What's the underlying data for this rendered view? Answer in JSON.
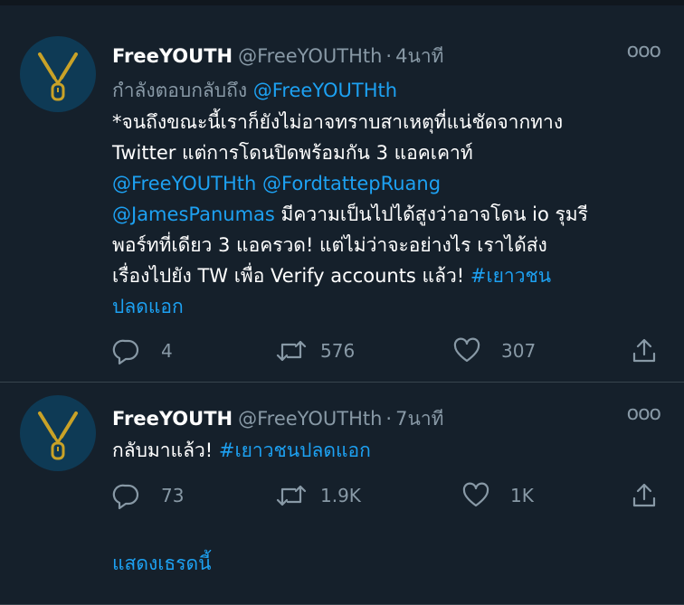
{
  "tweets": [
    {
      "name": "FreeYOUTH",
      "handle": "@FreeYOUTHth",
      "separator": "·",
      "time": "4นาที",
      "more": "ooo",
      "replying_prefix": "กำลังตอบกลับถึง",
      "replying_handle": "@FreeYOUTHth",
      "text_line1": "*จนถึงขณะนี้เราก็ยังไม่อาจทราบสาเหตุที่แน่ชัดจากทาง",
      "text_line2": "Twitter แต่การโดนปิดพร้อมกัน 3 แอคเคาท์",
      "mention1": "@FreeYOUTHth",
      "mention2": "@FordtattepRuang",
      "mention3": "@JamesPanumas",
      "text_after_mentions": " มีความเป็นไปได้สูงว่าอาจโดน io รุมรี",
      "text_line5": "พอร์ทที่เดียว 3 แอครวด! แต่ไม่ว่าจะอย่างไร เราได้ส่ง",
      "text_line6": "เรื่องไปยัง TW เพื่อ Verify accounts แล้ว! ",
      "hashtag_part1": "#เยาวชน",
      "hashtag_part2": "ปลดแอก",
      "replies": "4",
      "retweets": "576",
      "likes": "307"
    },
    {
      "name": "FreeYOUTH",
      "handle": "@FreeYOUTHth",
      "separator": "·",
      "time": "7นาที",
      "more": "ooo",
      "text_plain": "กลับมาแล้ว! ",
      "hashtag": "#เยาวชนปลดแอก",
      "replies": "73",
      "retweets": "1.9K",
      "likes": "1K"
    }
  ],
  "show_thread": "แสดงเธรดนี้",
  "colors": {
    "background": "#15202b",
    "link": "#1da1f2",
    "muted": "#8899a6",
    "avatar_bg": "#0e3a55",
    "avatar_logo": "#c9a227"
  },
  "icons": [
    "avatar-logo-icon",
    "more-icon",
    "reply-icon",
    "retweet-icon",
    "like-icon",
    "share-icon"
  ]
}
